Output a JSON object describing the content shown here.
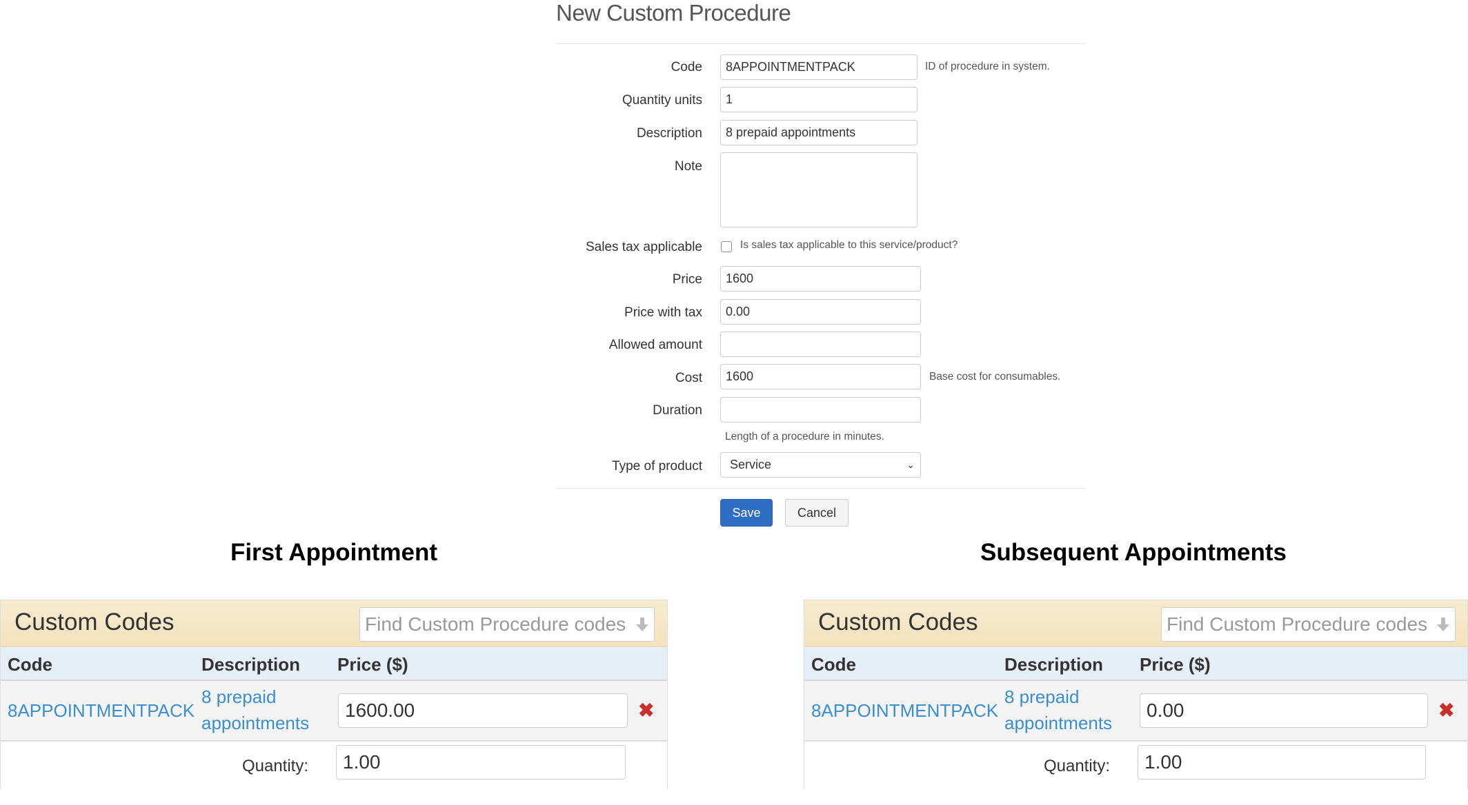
{
  "form": {
    "title": "New Custom Procedure",
    "fields": {
      "code": {
        "label": "Code",
        "value": "8APPOINTMENTPACK",
        "help": "ID of procedure in system."
      },
      "quantity_units": {
        "label": "Quantity units",
        "value": "1"
      },
      "description": {
        "label": "Description",
        "value": "8 prepaid appointments"
      },
      "note": {
        "label": "Note",
        "value": ""
      },
      "sales_tax": {
        "label": "Sales tax applicable",
        "checked": false,
        "help": "Is sales tax applicable to this service/product?"
      },
      "price": {
        "label": "Price",
        "value": "1600"
      },
      "price_with_tax": {
        "label": "Price with tax",
        "value": "0.00"
      },
      "allowed_amount": {
        "label": "Allowed amount",
        "value": ""
      },
      "cost": {
        "label": "Cost",
        "value": "1600",
        "help": "Base cost for consumables."
      },
      "duration": {
        "label": "Duration",
        "value": "",
        "help": "Length of a procedure in minutes."
      },
      "type_of_product": {
        "label": "Type of product",
        "value": "Service"
      }
    },
    "save_label": "Save",
    "cancel_label": "Cancel"
  },
  "sections": {
    "first": "First Appointment",
    "subsequent": "Subsequent Appointments"
  },
  "panels": [
    {
      "title": "Custom Codes",
      "search_placeholder": "Find Custom Procedure codes",
      "columns": [
        "Code",
        "Description",
        "Price ($)"
      ],
      "row": {
        "code": "8APPOINTMENTPACK",
        "description_line1": "8 prepaid",
        "description_line2": "appointments",
        "price": "1600.00"
      },
      "quantity_label": "Quantity:",
      "quantity": "1.00",
      "remove_icon": "✖"
    },
    {
      "title": "Custom Codes",
      "search_placeholder": "Find Custom Procedure codes",
      "columns": [
        "Code",
        "Description",
        "Price ($)"
      ],
      "row": {
        "code": "8APPOINTMENTPACK",
        "description_line1": "8 prepaid",
        "description_line2": "appointments",
        "price": "0.00"
      },
      "quantity_label": "Quantity:",
      "quantity": "1.00",
      "remove_icon": "✖"
    }
  ],
  "colors": {
    "primary": "#2e6dc4",
    "link": "#3a8ed3",
    "danger": "#c9302c",
    "panel_header": "#f5e6c6",
    "table_header": "#e6eef8"
  }
}
